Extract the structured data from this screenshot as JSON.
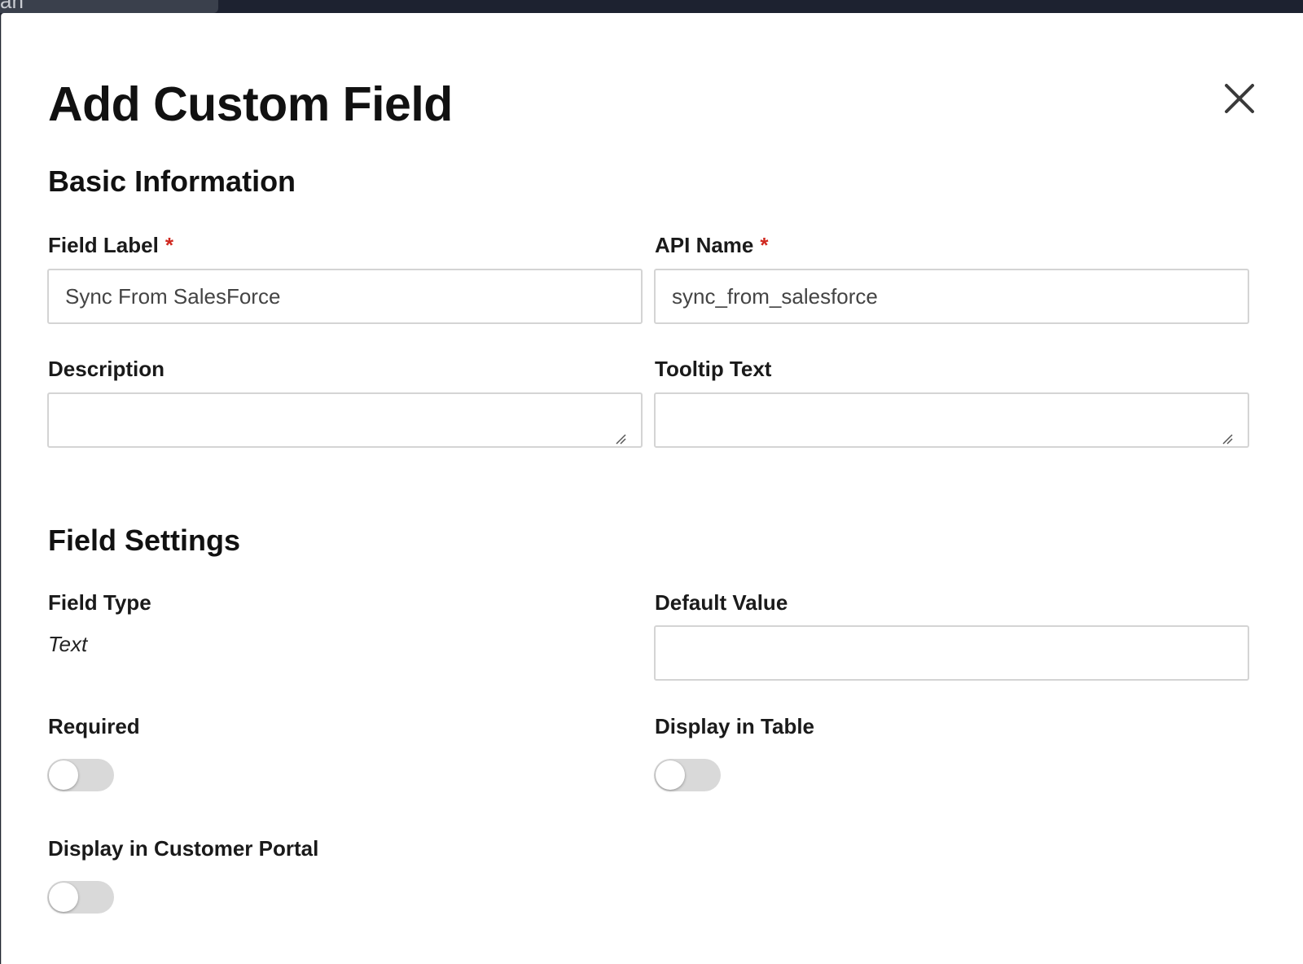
{
  "background_tab": {
    "text": "an"
  },
  "modal": {
    "title": "Add Custom Field",
    "close_icon": "close-icon"
  },
  "basic_information": {
    "heading": "Basic Information",
    "field_label": {
      "label": "Field Label",
      "required_marker": "*",
      "value": "Sync From SalesForce"
    },
    "api_name": {
      "label": "API Name",
      "required_marker": "*",
      "value": "sync_from_salesforce"
    },
    "description": {
      "label": "Description",
      "value": ""
    },
    "tooltip_text": {
      "label": "Tooltip Text",
      "value": ""
    }
  },
  "field_settings": {
    "heading": "Field Settings",
    "field_type": {
      "label": "Field Type",
      "value": "Text"
    },
    "default_value": {
      "label": "Default Value",
      "value": ""
    },
    "required": {
      "label": "Required",
      "enabled": false
    },
    "display_in_table": {
      "label": "Display in Table",
      "enabled": false
    },
    "display_in_customer_portal": {
      "label": "Display in Customer Portal",
      "enabled": false
    }
  },
  "colors": {
    "required_marker": "#d0281f",
    "toggle_off_track": "#d9d9d9",
    "input_border": "#d4d4d4",
    "top_bar": "#1d2230"
  }
}
